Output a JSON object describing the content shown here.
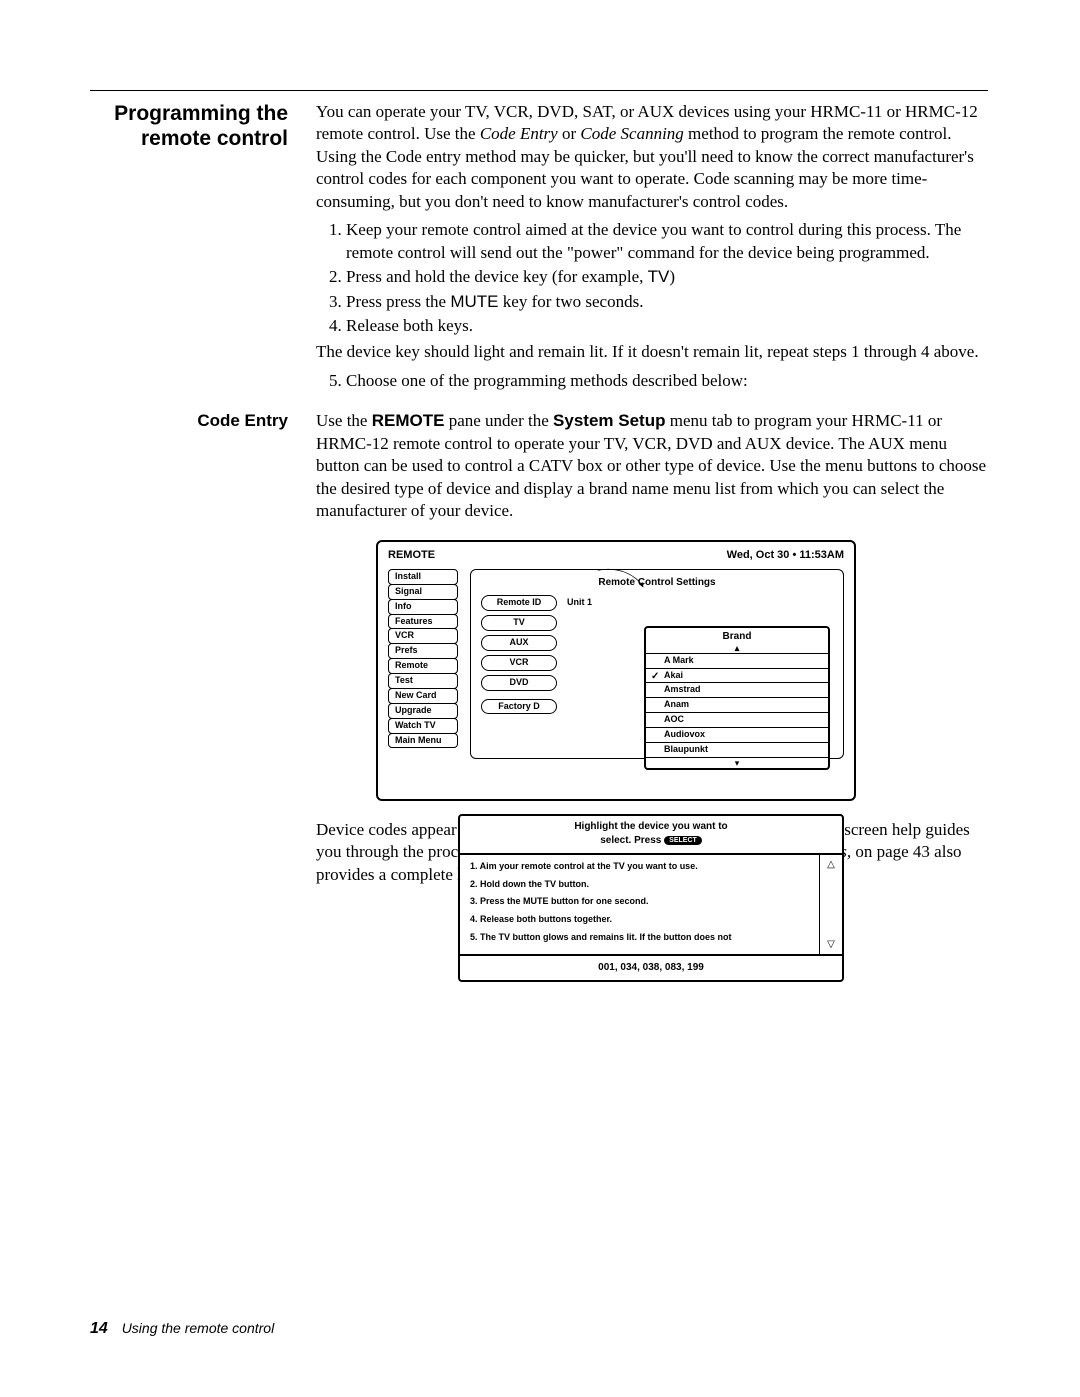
{
  "section": {
    "title": "Programming the remote control",
    "para1a": "You can operate your TV, VCR, DVD, SAT, or AUX devices using your HRMC-11 or HRMC-12 remote control. Use the ",
    "para1b": "Code Entry",
    "para1c": " or ",
    "para1d": "Code Scanning",
    "para1e": " method to program the remote control. Using the Code entry method may be quicker, but you'll need to know the correct manufacturer's control codes for each component you want to operate. Code scanning may be more time-consuming, but you don't need to know manufacturer's control codes.",
    "step1": "Keep your remote control aimed at the device you want to control during this process. The remote control will send out the \"power\" command for the device being programmed.",
    "step2a": "Press and hold the device key (for example, ",
    "step2b": "TV",
    "step2c": ")",
    "step3a": "Press press the ",
    "step3b": "MUTE",
    "step3c": " key for two seconds.",
    "step4": "Release both keys.",
    "afterSteps": "The device key should light and remain lit. If it doesn't remain lit, repeat steps 1 through 4 above.",
    "step5": "Choose one of the programming methods described below:"
  },
  "codeEntry": {
    "title": "Code Entry",
    "p_a": "Use the ",
    "p_b": "REMOTE",
    "p_c": " pane under the ",
    "p_d": "System Setup",
    "p_e": " menu tab to program your HRMC-11 or HRMC-12 remote control to operate your TV, VCR, DVD and AUX device. The AUX menu button can be used to control a CATV box or other type of device. Use the menu buttons to choose the desired type of device and display a brand name menu list from which you can select the manufacturer of your device.",
    "after_a": "Device codes appear in the menu pane for the brand selected. Step-by-step onscreen help guides you through the procedure. Appendix B – ",
    "after_b": "Manufacturers device control codes,",
    "after_c": " on page 43 also provides a complete list of device codes."
  },
  "diagram": {
    "header_left": "REMOTE",
    "header_right": "Wed, Oct 30 • 11:53AM",
    "menu": [
      "Install",
      "Signal",
      "Info",
      "Features",
      "VCR",
      "Prefs",
      "Remote",
      "Test",
      "New Card",
      "Upgrade",
      "Watch TV",
      "Main Menu"
    ],
    "pane_title": "Remote Control Settings",
    "remote_id_label": "Remote ID",
    "remote_id_value": "Unit 1",
    "buttons": [
      "TV",
      "AUX",
      "VCR",
      "DVD"
    ],
    "factory": "Factory D",
    "brand_header": "Brand",
    "brands": [
      "A Mark",
      "Akai",
      "Amstrad",
      "Anam",
      "AOC",
      "Audiovox",
      "Blaupunkt"
    ],
    "brand_selected_index": 1,
    "help_top_a": "Highlight the device you want to",
    "help_top_b": "select. Press",
    "help_top_btn": "SELECT",
    "help_steps": [
      "1. Aim your remote control at the TV you want to use.",
      "2. Hold down the TV button.",
      "3. Press the MUTE button for one second.",
      "4. Release both buttons together.",
      "5. The TV button glows and remains lit. If the button does not"
    ],
    "codes": "001, 034, 038, 083, 199"
  },
  "footer": {
    "page": "14",
    "chapter": "Using the remote control"
  }
}
